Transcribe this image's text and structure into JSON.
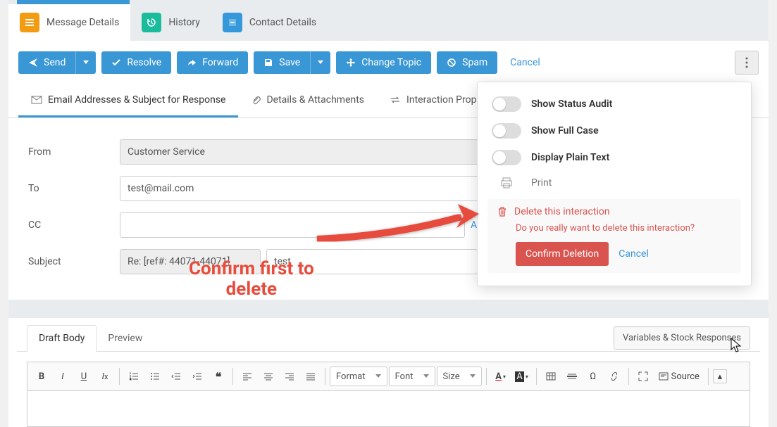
{
  "tabs": {
    "message": "Message Details",
    "history": "History",
    "contact": "Contact Details"
  },
  "toolbar": {
    "send": "Send",
    "resolve": "Resolve",
    "forward": "Forward",
    "save": "Save",
    "changeTopic": "Change Topic",
    "spam": "Spam",
    "cancel": "Cancel"
  },
  "subtabs": {
    "emails": "Email Addresses & Subject for Response",
    "details": "Details & Attachments",
    "interaction": "Interaction Properties"
  },
  "form": {
    "fromLabel": "From",
    "fromValue": "Customer Service",
    "toLabel": "To",
    "toValue": "test@mail.com",
    "ccLabel": "CC",
    "ccValue": "",
    "addCc": "Ad",
    "subjectLabel": "Subject",
    "subjectPrefix": "Re: [ref#: 44071-44071]",
    "subjectValue": "test"
  },
  "editor": {
    "draft": "Draft Body",
    "preview": "Preview",
    "variables": "Variables & Stock Responses",
    "format": "Format",
    "font": "Font",
    "size": "Size",
    "source": "Source"
  },
  "dropdown": {
    "showAudit": "Show Status Audit",
    "showFull": "Show Full Case",
    "plainText": "Display Plain Text",
    "print": "Print",
    "deleteTitle": "Delete this interaction",
    "deleteMsg": "Do you really want to delete this interaction?",
    "confirm": "Confirm Deletion",
    "cancel": "Cancel"
  },
  "annotation": "Confirm first to\ndelete",
  "colors": {
    "primary": "#3a97d6",
    "danger": "#d9534f"
  }
}
